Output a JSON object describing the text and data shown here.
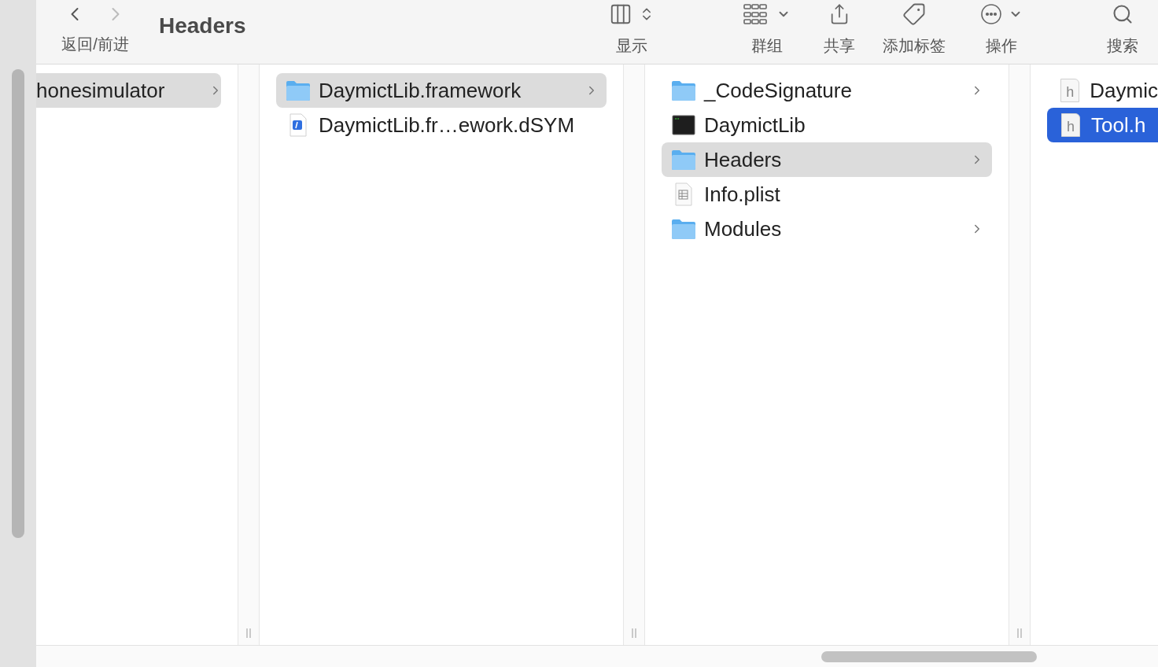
{
  "toolbar": {
    "back_forward": {
      "label": "返回/前进",
      "back_disabled": false,
      "forward_disabled": true
    },
    "title": "Headers",
    "items": [
      {
        "kind": "view",
        "label": "显示"
      },
      {
        "kind": "group",
        "label": "群组"
      },
      {
        "kind": "share",
        "label": "共享"
      },
      {
        "kind": "tag",
        "label": "添加标签"
      },
      {
        "kind": "action",
        "label": "操作"
      },
      {
        "kind": "search",
        "label": "搜索"
      }
    ]
  },
  "columns": [
    {
      "active": false,
      "items": [
        {
          "name": "honesimulator",
          "kind": "none",
          "expandable": true,
          "selected": true
        }
      ]
    },
    {
      "active": false,
      "items": [
        {
          "name": "DaymictLib.framework",
          "kind": "folder",
          "expandable": true,
          "selected": true
        },
        {
          "name": "DaymictLib.fr…ework.dSYM",
          "kind": "dsym",
          "expandable": false,
          "selected": false
        }
      ]
    },
    {
      "active": false,
      "items": [
        {
          "name": "_CodeSignature",
          "kind": "folder",
          "expandable": true,
          "selected": false
        },
        {
          "name": "DaymictLib",
          "kind": "exec",
          "expandable": false,
          "selected": false
        },
        {
          "name": "Headers",
          "kind": "folder",
          "expandable": true,
          "selected": true
        },
        {
          "name": "Info.plist",
          "kind": "plist",
          "expandable": false,
          "selected": false
        },
        {
          "name": "Modules",
          "kind": "folder",
          "expandable": true,
          "selected": false
        }
      ]
    },
    {
      "active": true,
      "items": [
        {
          "name": "Daymic",
          "kind": "header",
          "icon_letter": "h",
          "expandable": false,
          "selected": false
        },
        {
          "name": "Tool.h",
          "kind": "header",
          "icon_letter": "h",
          "expandable": false,
          "selected": true
        }
      ]
    }
  ]
}
